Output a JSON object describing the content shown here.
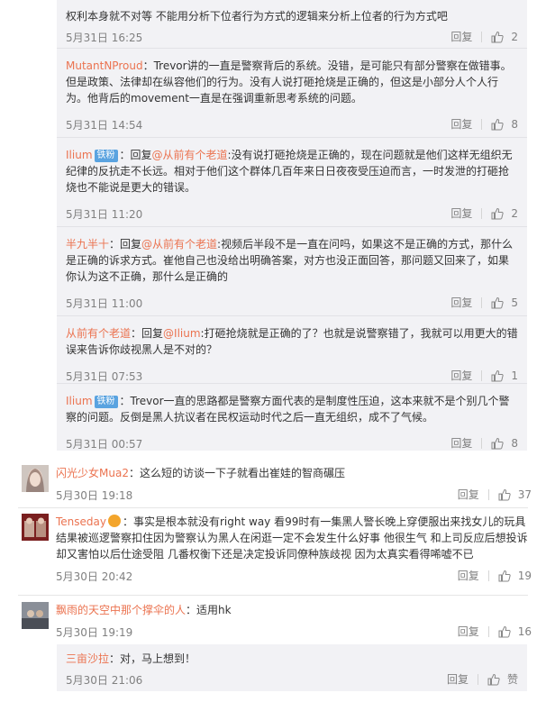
{
  "like_icon": "thumbs-up-icon",
  "colors": {
    "username": "#eb7350",
    "badge": "#5aa3e0",
    "reply_bg": "#f2f2f5",
    "meta": "#808080"
  },
  "replies": [
    {
      "user": "",
      "badge": "",
      "prefix": "",
      "mention": "",
      "text": "权利本身就不对等 不能用分析下位者行为方式的逻辑来分析上位者的行为方式吧",
      "time": "5月31日 16:25",
      "reply_label": "回复",
      "likes": "2"
    },
    {
      "user": "MutantNProud",
      "badge": "",
      "prefix": "",
      "mention": "",
      "text": "：Trevor讲的一直是警察背后的系统。没错，是可能只有部分警察在做错事。但是政策、法律却在纵容他们的行为。没有人说打砸抢烧是正确的，但这是小部分人个人行为。他背后的movement一直是在强调重新思考系统的问题。",
      "time": "5月31日 14:54",
      "reply_label": "回复",
      "likes": "8"
    },
    {
      "user": "Ilium",
      "badge": "铁粉",
      "prefix": "：回复",
      "mention": "@从前有个老道",
      "text": ":没有说打砸抢烧是正确的，现在问题就是他们这样无组织无纪律的反抗走不长远。相对于他们这个群体几百年来日日夜夜受压迫而言，一时发泄的打砸抢烧也不能说是更大的错误。",
      "time": "5月31日 11:20",
      "reply_label": "回复",
      "likes": "2"
    },
    {
      "user": "半九半十",
      "badge": "",
      "prefix": "：回复",
      "mention": "@从前有个老道",
      "text": ":视频后半段不是一直在问吗，如果这不是正确的方式，那什么是正确的诉求方式。崔他自己也没给出明确答案，对方也没正面回答，那问题又回来了，如果你认为这不正确，那什么是正确的",
      "time": "5月31日 11:00",
      "reply_label": "回复",
      "likes": "5"
    },
    {
      "user": "从前有个老道",
      "badge": "",
      "prefix": "：回复",
      "mention": "@Ilium",
      "text": ":打砸抢烧就是正确的了？也就是说警察错了，我就可以用更大的错误来告诉你歧视黑人是不对的？",
      "time": "5月31日 07:53",
      "reply_label": "回复",
      "likes": "1"
    },
    {
      "user": "Ilium",
      "badge": "铁粉",
      "prefix": "",
      "mention": "",
      "text": "：Trevor一直的思路都是警察方面代表的是制度性压迫，这本来就不是个别几个警察的问题。反倒是黑人抗议者在民权运动时代之后一直无组织，成不了气候。",
      "time": "5月31日 00:57",
      "reply_label": "回复",
      "likes": "8"
    }
  ],
  "comments": [
    {
      "user": "闪光少女Mua2",
      "badge": "",
      "text": "：这么短的访谈一下子就看出崔娃的智商碾压",
      "time": "5月30日 19:18",
      "reply_label": "回复",
      "likes": "37"
    },
    {
      "user": "Tenseday",
      "badge": "",
      "text": "：事实是根本就没有right way  看99时有一集黑人警长晚上穿便服出来找女儿的玩具结果被巡逻警察扣住因为警察认为黑人在闲逛一定不会发生什么好事  他很生气 和上司反应后想投诉却又害怕以后仕途受阻 几番权衡下还是决定投诉同僚种族歧视 因为太真实看得唏嘘不已",
      "time": "5月30日 20:42",
      "reply_label": "回复",
      "likes": "19"
    },
    {
      "user": "飘雨的天空中那个撑伞的人",
      "badge": "",
      "text": "：适用hk",
      "time": "5月30日 19:19",
      "reply_label": "回复",
      "likes": "16"
    }
  ],
  "nested_reply": {
    "user": "三亩沙拉",
    "text": "：对，马上想到！",
    "time": "5月30日 21:06",
    "reply_label": "回复",
    "likes": "赞"
  }
}
